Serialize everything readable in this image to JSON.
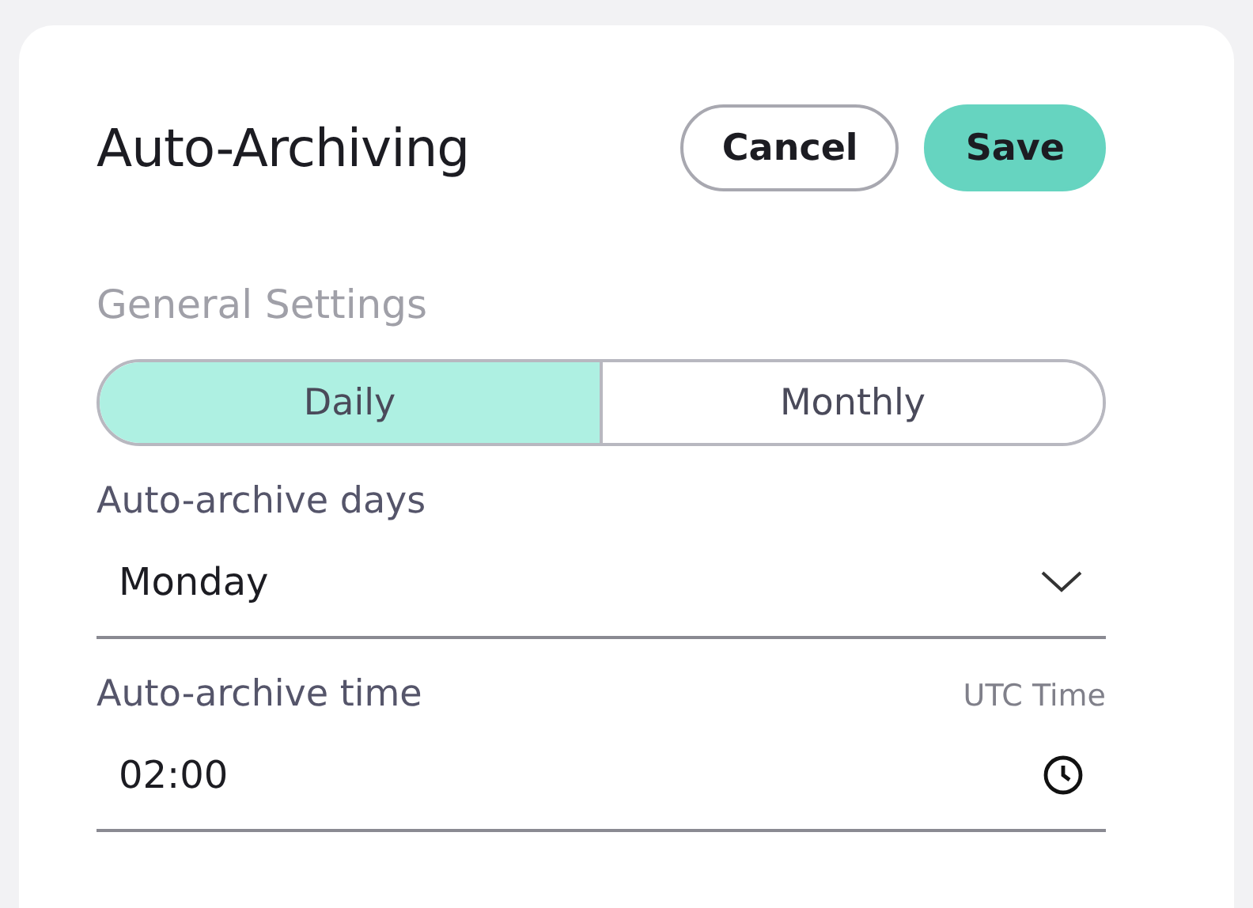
{
  "title": "Auto-Archiving",
  "buttons": [
    {
      "label": "Cancel",
      "kind": "secondary"
    },
    {
      "label": "Save",
      "kind": "primary"
    }
  ],
  "section_title": "General Settings",
  "tabs": [
    {
      "label": "Daily",
      "selected": true
    },
    {
      "label": "Monthly",
      "selected": false
    }
  ],
  "days_field": {
    "label": "Auto-archive days",
    "value": "Monday"
  },
  "time_field": {
    "label": "Auto-archive time",
    "hint": "UTC Time",
    "value": "02:00"
  }
}
